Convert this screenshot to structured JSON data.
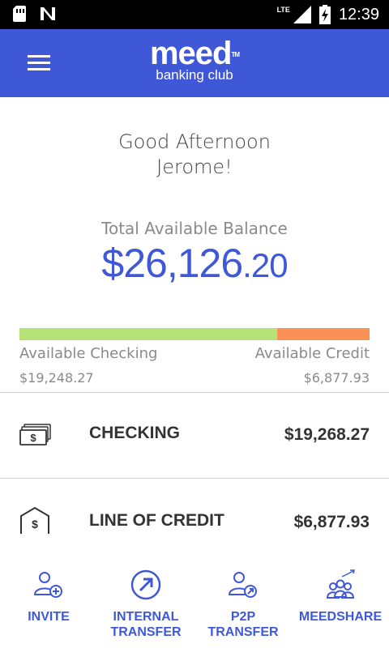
{
  "status_bar": {
    "time": "12:39",
    "network": "LTE",
    "icons": [
      "sim-card-icon",
      "n-icon",
      "signal-icon",
      "battery-charging-icon"
    ]
  },
  "header": {
    "brand": "meed",
    "tagline": "banking club",
    "trademark": "TM",
    "menu_icon": "hamburger-icon"
  },
  "greeting": {
    "line1": "Good Afternoon",
    "line2": "Jerome!"
  },
  "balance": {
    "label": "Total Available Balance",
    "whole": "$26,126",
    "cents": ".20"
  },
  "breakdown": {
    "checking_fraction": 0.737,
    "checking_color": "#b7e27a",
    "credit_color": "#fb9156",
    "checking_label": "Available Checking",
    "credit_label": "Available Credit",
    "checking_value": "$19,248.27",
    "credit_value": "$6,877.93"
  },
  "accounts": [
    {
      "name": "CHECKING",
      "amount": "$19,268.27",
      "icon": "cash-icon"
    },
    {
      "name": "LINE OF CREDIT",
      "amount": "$6,877.93",
      "icon": "credit-house-icon"
    }
  ],
  "actions": [
    {
      "label": "INVITE",
      "icon": "invite-user-icon"
    },
    {
      "label_line1": "INTERNAL",
      "label_line2": "TRANSFER",
      "icon": "internal-transfer-icon"
    },
    {
      "label": "P2P TRANSFER",
      "icon": "p2p-transfer-icon"
    },
    {
      "label": "MEEDSHARE",
      "icon": "meedshare-icon"
    }
  ],
  "colors": {
    "brand_blue": "#3f58d8",
    "text_gray": "#8a8a8a"
  }
}
